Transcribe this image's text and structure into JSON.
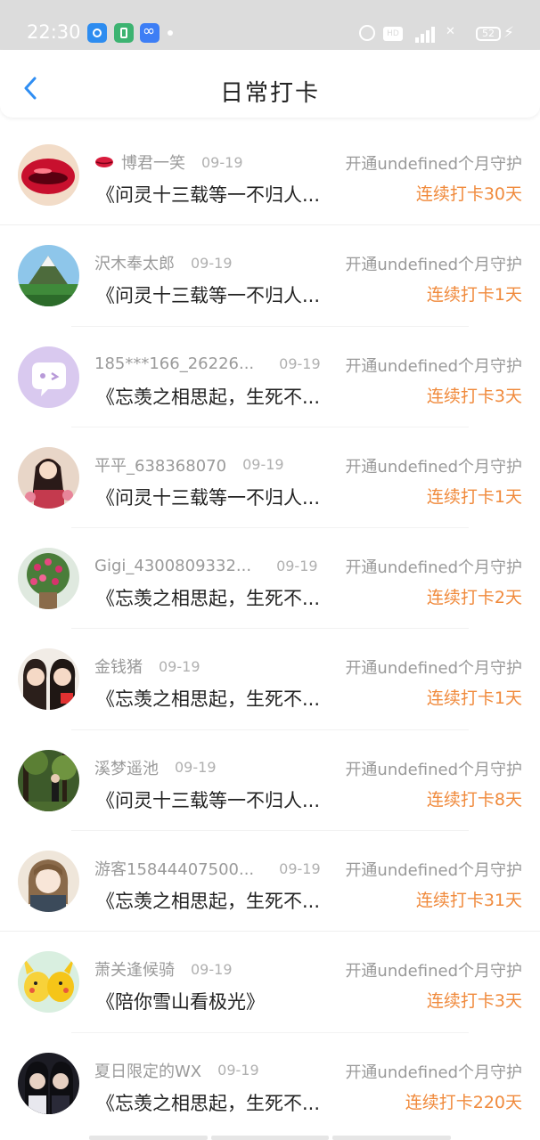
{
  "status_bar": {
    "time": "22:30",
    "battery": "52",
    "hd_label": "HD"
  },
  "header": {
    "title": "日常打卡",
    "back_icon": "chevron-left-icon",
    "accent_color": "#2f8ef3"
  },
  "list": {
    "guard_label_color": "#9a9a9a",
    "streak_color": "#f08a3c",
    "items": [
      {
        "name": "博君一笑",
        "date": "09-19",
        "guard": "开通undefined个月守护",
        "song": "《问灵十三载等一不归人...",
        "streak": "连续打卡30天",
        "badge": "lips-icon"
      },
      {
        "name": "沢木奉太郎",
        "date": "09-19",
        "guard": "开通undefined个月守护",
        "song": "《问灵十三载等一不归人...",
        "streak": "连续打卡1天"
      },
      {
        "name": "185***166_26226...",
        "date": "09-19",
        "guard": "开通undefined个月守护",
        "song": "《忘羡之相思起，生死不...",
        "streak": "连续打卡3天"
      },
      {
        "name": "平平_638368070",
        "date": "09-19",
        "guard": "开通undefined个月守护",
        "song": "《问灵十三载等一不归人...",
        "streak": "连续打卡1天"
      },
      {
        "name": "Gigi_4300809332...",
        "date": "09-19",
        "guard": "开通undefined个月守护",
        "song": "《忘羡之相思起，生死不...",
        "streak": "连续打卡2天"
      },
      {
        "name": "金钱猪",
        "date": "09-19",
        "guard": "开通undefined个月守护",
        "song": "《忘羡之相思起，生死不...",
        "streak": "连续打卡1天"
      },
      {
        "name": "溪梦遥池",
        "date": "09-19",
        "guard": "开通undefined个月守护",
        "song": "《问灵十三载等一不归人...",
        "streak": "连续打卡8天"
      },
      {
        "name": "游客15844407500...",
        "date": "09-19",
        "guard": "开通undefined个月守护",
        "song": "《忘羡之相思起，生死不...",
        "streak": "连续打卡31天"
      },
      {
        "name": "萧关逢候骑",
        "date": "09-19",
        "guard": "开通undefined个月守护",
        "song": "《陪你雪山看极光》",
        "streak": "连续打卡3天"
      },
      {
        "name": "夏日限定的WX",
        "date": "09-19",
        "guard": "开通undefined个月守护",
        "song": "《忘羡之相思起，生死不...",
        "streak": "连续打卡220天"
      }
    ]
  }
}
